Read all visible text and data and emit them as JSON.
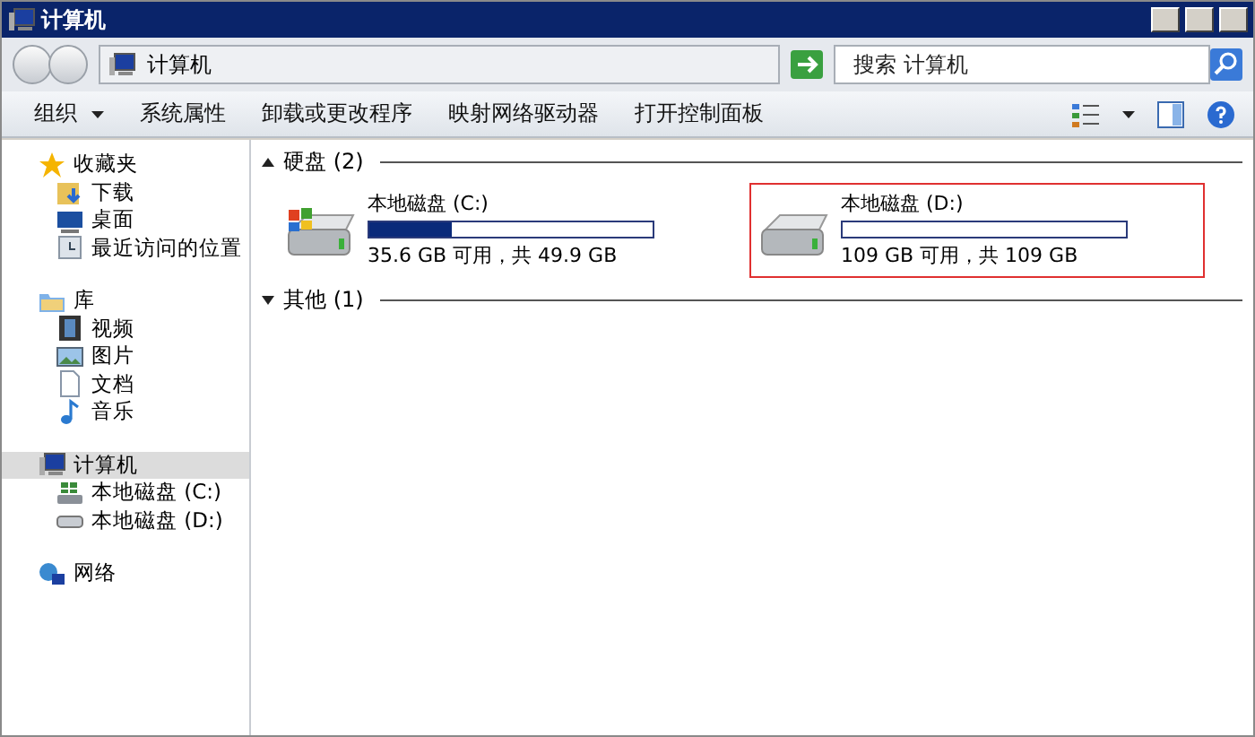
{
  "window": {
    "title": "计算机"
  },
  "address": {
    "path": "计算机",
    "search_placeholder": "搜索 计算机"
  },
  "toolbar": {
    "items": [
      {
        "label": "组织",
        "dropdown": true
      },
      {
        "label": "系统属性",
        "dropdown": false
      },
      {
        "label": "卸载或更改程序",
        "dropdown": false
      },
      {
        "label": "映射网络驱动器",
        "dropdown": false
      },
      {
        "label": "打开控制面板",
        "dropdown": false
      }
    ]
  },
  "sidebar": {
    "groups": [
      {
        "label": "收藏夹",
        "kind": "star",
        "selected": false,
        "children": [
          {
            "label": "下载",
            "kind": "download",
            "selected": false
          },
          {
            "label": "桌面",
            "kind": "desktop",
            "selected": false
          },
          {
            "label": "最近访问的位置",
            "kind": "recent",
            "selected": false
          }
        ]
      },
      {
        "label": "库",
        "kind": "library",
        "selected": false,
        "children": [
          {
            "label": "视频",
            "kind": "video",
            "selected": false
          },
          {
            "label": "图片",
            "kind": "picture",
            "selected": false
          },
          {
            "label": "文档",
            "kind": "document",
            "selected": false
          },
          {
            "label": "音乐",
            "kind": "music",
            "selected": false
          }
        ]
      },
      {
        "label": "计算机",
        "kind": "computer",
        "selected": true,
        "children": [
          {
            "label": "本地磁盘 (C:)",
            "kind": "system-drive",
            "selected": false
          },
          {
            "label": "本地磁盘 (D:)",
            "kind": "drive",
            "selected": false
          }
        ]
      },
      {
        "label": "网络",
        "kind": "network",
        "selected": false
      }
    ]
  },
  "sections": [
    {
      "label": "硬盘 (2)",
      "expanded": true,
      "drives": [
        {
          "name": "本地磁盘 (C:)",
          "kind": "system-drive",
          "level": 0.29,
          "space": "35.6 GB 可用，共 49.9 GB",
          "highlighted": false
        },
        {
          "name": "本地磁盘 (D:)",
          "kind": "drive",
          "level": 0,
          "space": "109 GB 可用，共 109 GB",
          "highlighted": true
        }
      ]
    },
    {
      "label": "其他 (1)",
      "expanded": false
    }
  ]
}
